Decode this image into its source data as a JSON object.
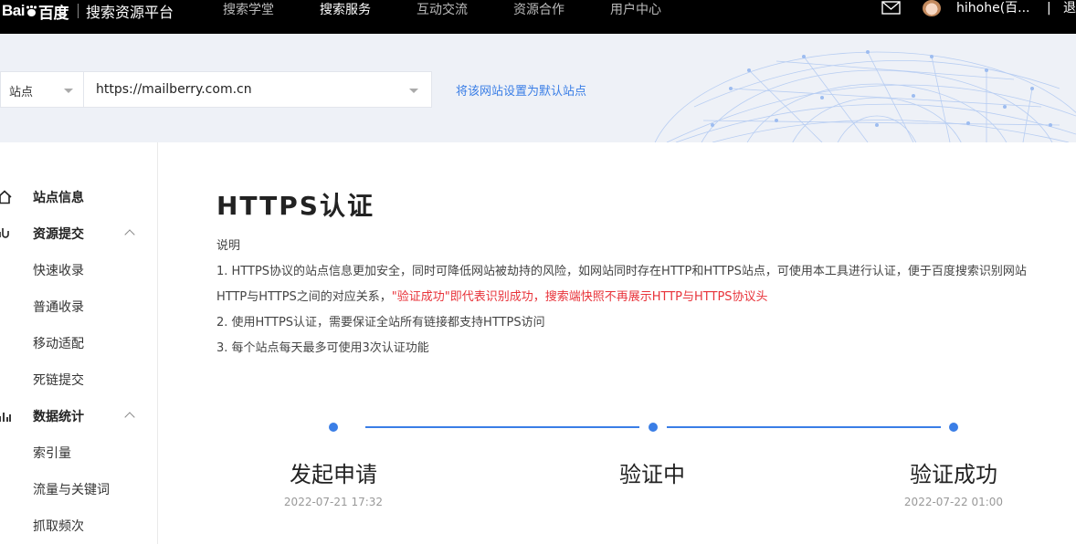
{
  "topbar": {
    "logo_left": "Bai",
    "logo_right": "百度",
    "logo_sub": "搜索资源平台",
    "nav": [
      "搜索学堂",
      "搜索服务",
      "互动交流",
      "资源合作",
      "用户中心"
    ],
    "active_nav": "搜索服务",
    "username": "hihohe(百...",
    "divider": "|",
    "logout": "退"
  },
  "site_bar": {
    "selector_label": "站点",
    "site_value": "https://mailberry.com.cn",
    "set_default_link": "将该网站设置为默认站点"
  },
  "sidebar": {
    "site_info": "站点信息",
    "resource_submit": "资源提交",
    "resource_items": [
      "快速收录",
      "普通收录",
      "移动适配",
      "死链提交"
    ],
    "data_stats": "数据统计",
    "data_items": [
      "索引量",
      "流量与关键词",
      "抓取频次"
    ]
  },
  "main": {
    "title": "HTTPS认证",
    "desc_heading": "说明",
    "line1": "1. HTTPS协议的站点信息更加安全，同时可降低网站被劫持的风险，如网站同时存在HTTP和HTTPS站点，可使用本工具进行认证，便于百度搜索识别网站",
    "line2_prefix": "HTTP与HTTPS之间的对应关系，",
    "line2_red": "\"验证成功\"即代表识别成功，搜索端快照不再展示HTTP与HTTPS协议头",
    "line3": "2. 使用HTTPS认证，需要保证全站所有链接都支持HTTPS访问",
    "line4": "3. 每个站点每天最多可使用3次认证功能"
  },
  "steps": [
    {
      "label": "发起申请",
      "time": "2022-07-21 17:32"
    },
    {
      "label": "验证中",
      "time": ""
    },
    {
      "label": "验证成功",
      "time": "2022-07-22 01:00"
    }
  ],
  "colors": {
    "accent": "#3a7ee6",
    "warning_text": "#e8333a",
    "topbar": "#000000",
    "sitebar_bg": "#eef1f7"
  },
  "icons": {
    "mail": "mail-icon",
    "avatar": "avatar",
    "site_info": "home-icon",
    "resource_submit": "link-icon",
    "data_stats": "bar-chart-icon"
  }
}
